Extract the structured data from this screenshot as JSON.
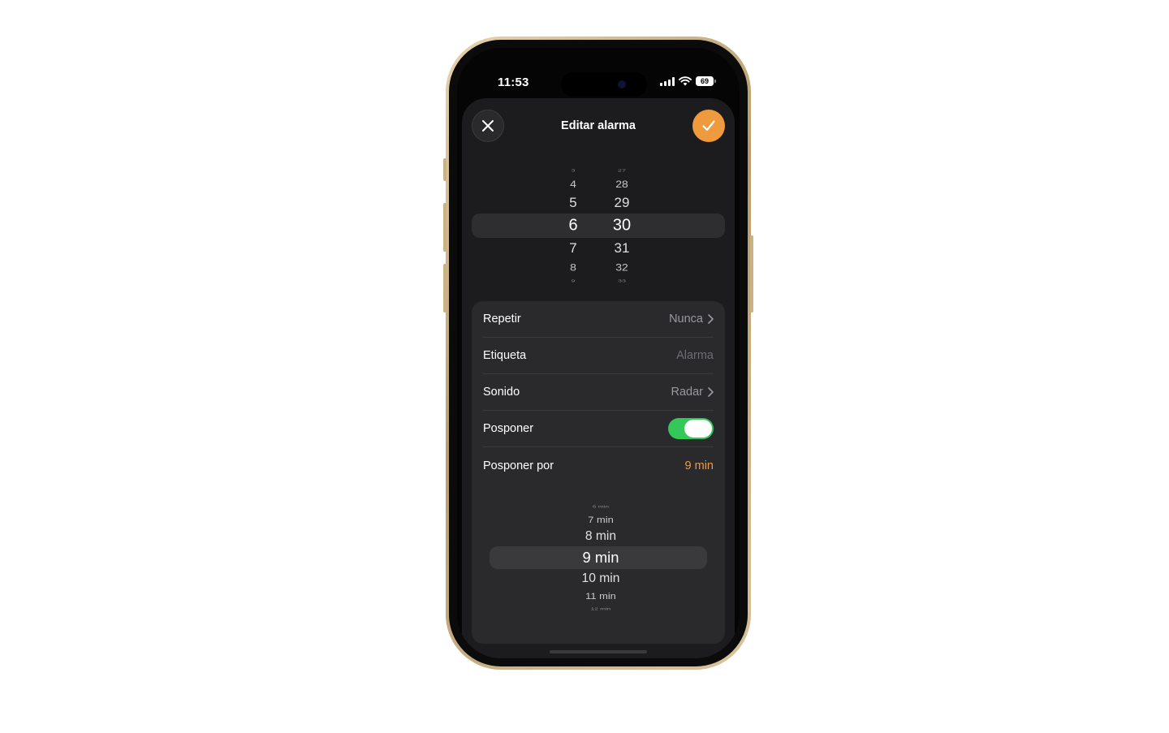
{
  "status_bar": {
    "time": "11:53",
    "battery": "69"
  },
  "header": {
    "title": "Editar alarma",
    "close_icon": "close-icon",
    "done_icon": "checkmark-icon"
  },
  "time_picker": {
    "hours": [
      "3",
      "4",
      "5",
      "6",
      "7",
      "8",
      "9"
    ],
    "minutes": [
      "27",
      "28",
      "29",
      "30",
      "31",
      "32",
      "33"
    ],
    "selected_hour": "6",
    "selected_minute": "30"
  },
  "settings": {
    "repeat": {
      "label": "Repetir",
      "value": "Nunca"
    },
    "label": {
      "label": "Etiqueta",
      "placeholder": "Alarma"
    },
    "sound": {
      "label": "Sonido",
      "value": "Radar"
    },
    "snooze": {
      "label": "Posponer",
      "on": true
    },
    "snooze_for": {
      "label": "Posponer por",
      "value": "9 min"
    }
  },
  "snooze_picker": {
    "options": [
      "6 min",
      "7 min",
      "8 min",
      "9 min",
      "10 min",
      "11 min",
      "12 min"
    ],
    "selected": "9 min"
  },
  "colors": {
    "accent": "#f09a3e",
    "toggle_on": "#34c759",
    "sheet_bg": "#1c1c1e",
    "card_bg": "#2a2a2d"
  }
}
